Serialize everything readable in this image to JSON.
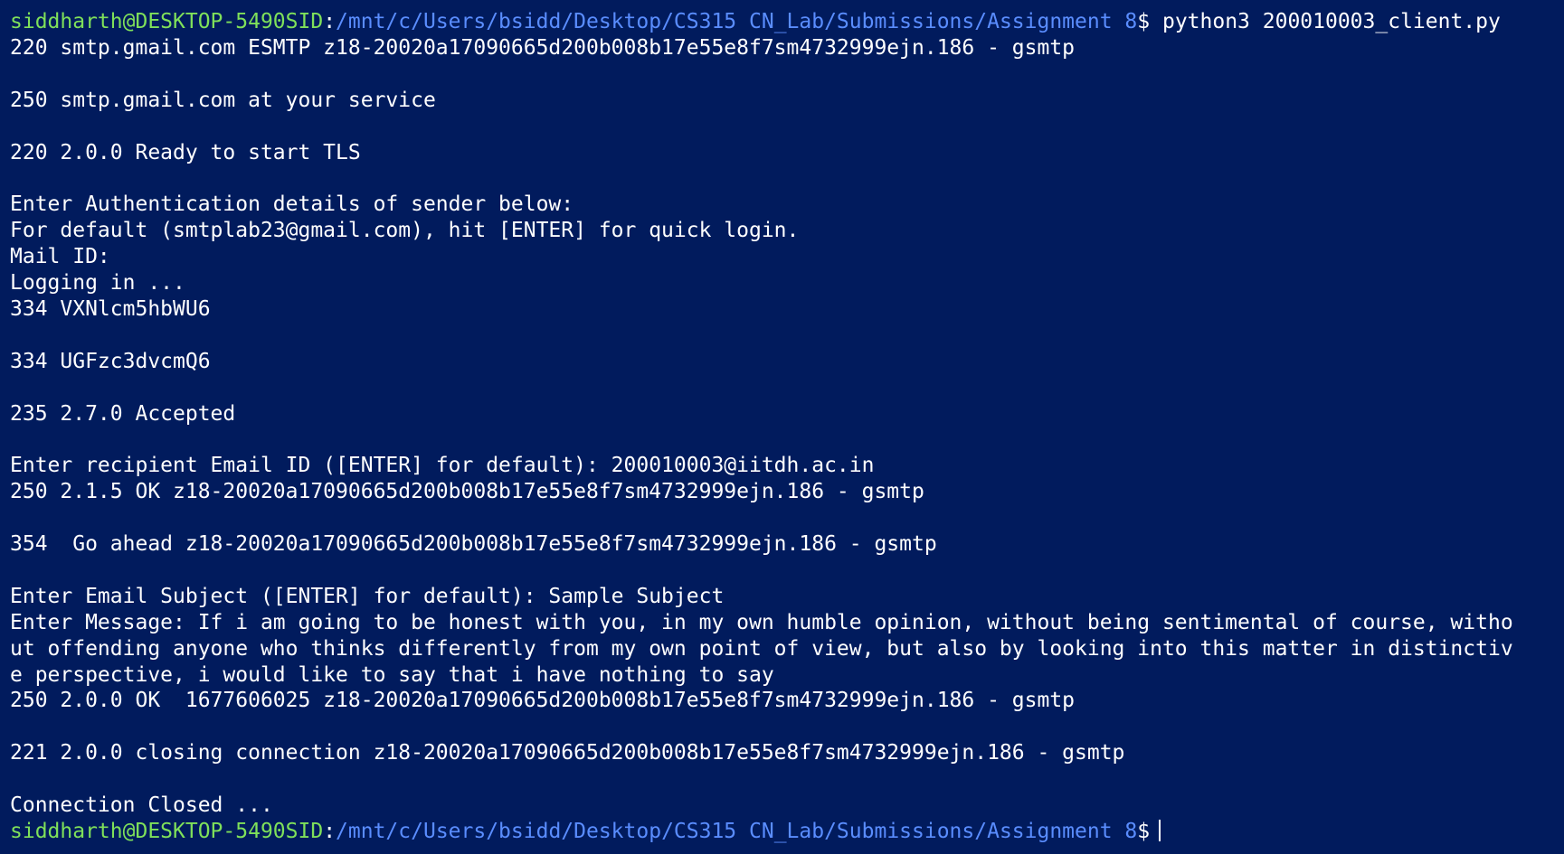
{
  "terminal": {
    "colors": {
      "background": "#011b5d",
      "user_host": "#7fe05a",
      "path": "#5a8dff",
      "text": "#ffffff"
    },
    "prompt_start": {
      "user_host": "siddharth@DESKTOP-5490SID",
      "separator": ":",
      "path": "/mnt/c/Users/bsidd/Desktop/CS315 CN_Lab/Submissions/Assignment 8",
      "symbol": "$",
      "command": " python3 200010003_client.py"
    },
    "output": [
      "220 smtp.gmail.com ESMTP z18-20020a17090665d200b008b17e55e8f7sm4732999ejn.186 - gsmtp",
      "",
      "250 smtp.gmail.com at your service",
      "",
      "220 2.0.0 Ready to start TLS",
      "",
      "Enter Authentication details of sender below:",
      "For default (smtplab23@gmail.com), hit [ENTER] for quick login.",
      "Mail ID:",
      "Logging in ...",
      "334 VXNlcm5hbWU6",
      "",
      "334 UGFzc3dvcmQ6",
      "",
      "235 2.7.0 Accepted",
      "",
      "Enter recipient Email ID ([ENTER] for default): 200010003@iitdh.ac.in",
      "250 2.1.5 OK z18-20020a17090665d200b008b17e55e8f7sm4732999ejn.186 - gsmtp",
      "",
      "354  Go ahead z18-20020a17090665d200b008b17e55e8f7sm4732999ejn.186 - gsmtp",
      "",
      "Enter Email Subject ([ENTER] for default): Sample Subject",
      "Enter Message: If i am going to be honest with you, in my own humble opinion, without being sentimental of course, witho",
      "ut offending anyone who thinks differently from my own point of view, but also by looking into this matter in distinctiv",
      "e perspective, i would like to say that i have nothing to say",
      "250 2.0.0 OK  1677606025 z18-20020a17090665d200b008b17e55e8f7sm4732999ejn.186 - gsmtp",
      "",
      "221 2.0.0 closing connection z18-20020a17090665d200b008b17e55e8f7sm4732999ejn.186 - gsmtp",
      "",
      "Connection Closed ..."
    ],
    "prompt_end": {
      "user_host": "siddharth@DESKTOP-5490SID",
      "separator": ":",
      "path": "/mnt/c/Users/bsidd/Desktop/CS315 CN_Lab/Submissions/Assignment 8",
      "symbol": "$",
      "command": " "
    }
  }
}
